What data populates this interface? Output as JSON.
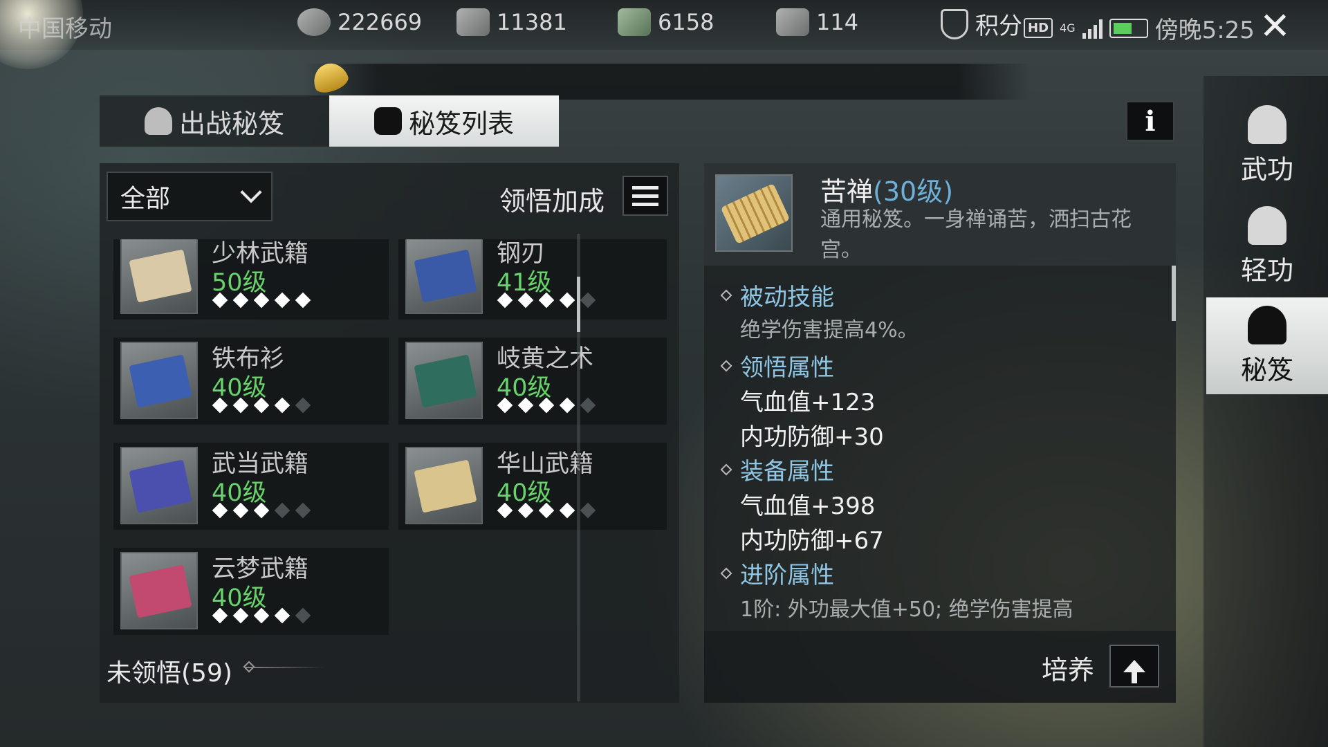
{
  "status_bar": {
    "carrier": "中国移动",
    "time": "傍晚5:25",
    "network": "4G",
    "hd": "HD",
    "score_label": "积分"
  },
  "resources": [
    {
      "icon": "silver-coin-icon",
      "value": "222669"
    },
    {
      "icon": "ingot-plus-icon",
      "value": "11381"
    },
    {
      "icon": "jade-plus-icon",
      "value": "6158"
    },
    {
      "icon": "gold-ingot-plus-icon",
      "value": "114"
    }
  ],
  "tabs": [
    {
      "label": "出战秘笈",
      "icon": "meditating-figure-icon",
      "active": false
    },
    {
      "label": "秘笈列表",
      "icon": "manual-icon",
      "active": true
    }
  ],
  "filter": {
    "selected": "全部"
  },
  "bonus_label": "领悟加成",
  "manuals": [
    {
      "name": "少林武籍",
      "level": "50级",
      "stars": 5,
      "max_stars": 5,
      "color": "#d9c9a6"
    },
    {
      "name": "钢刃",
      "level": "41级",
      "stars": 4,
      "max_stars": 5,
      "color": "#3a5aa8"
    },
    {
      "name": "铁布衫",
      "level": "40级",
      "stars": 4,
      "max_stars": 5,
      "color": "#3d5fb2"
    },
    {
      "name": "岐黄之术",
      "level": "40级",
      "stars": 4,
      "max_stars": 5,
      "color": "#2f6d5f"
    },
    {
      "name": "武当武籍",
      "level": "40级",
      "stars": 3,
      "max_stars": 5,
      "color": "#4b4fae"
    },
    {
      "name": "华山武籍",
      "level": "40级",
      "stars": 4,
      "max_stars": 5,
      "color": "#d8c48c"
    },
    {
      "name": "云梦武籍",
      "level": "40级",
      "stars": 4,
      "max_stars": 5,
      "color": "#c24a70"
    }
  ],
  "unlearned": "未领悟(59)",
  "detail": {
    "name": "苦禅",
    "level": "(30级)",
    "description": "通用秘笈。一身禅诵苦，洒扫古花宫。",
    "sections": [
      {
        "title": "被动技能",
        "lines": [
          "绝学伤害提高4%。"
        ]
      },
      {
        "title": "领悟属性",
        "lines": [
          "气血值+123",
          "内功防御+30"
        ]
      },
      {
        "title": "装备属性",
        "lines": [
          "气血值+398",
          "内功防御+67"
        ]
      },
      {
        "title": "进阶属性",
        "lines": [
          "1阶: 外功最大值+50; 绝学伤害提高"
        ]
      }
    ],
    "cultivate_label": "培养"
  },
  "side_nav": [
    {
      "label": "武功",
      "icon": "martial-arts-icon",
      "active": false
    },
    {
      "label": "轻功",
      "icon": "lightness-skill-icon",
      "active": false
    },
    {
      "label": "秘笈",
      "icon": "meditating-figure-icon",
      "active": true
    }
  ]
}
